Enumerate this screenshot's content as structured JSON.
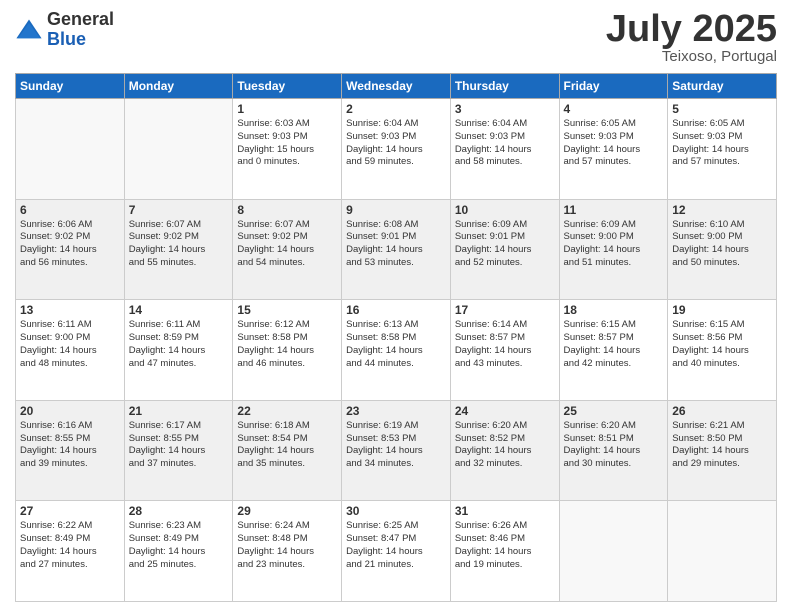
{
  "header": {
    "logo_general": "General",
    "logo_blue": "Blue",
    "month_title": "July 2025",
    "location": "Teixoso, Portugal"
  },
  "weekdays": [
    "Sunday",
    "Monday",
    "Tuesday",
    "Wednesday",
    "Thursday",
    "Friday",
    "Saturday"
  ],
  "weeks": [
    [
      {
        "day": "",
        "info": ""
      },
      {
        "day": "",
        "info": ""
      },
      {
        "day": "1",
        "info": "Sunrise: 6:03 AM\nSunset: 9:03 PM\nDaylight: 15 hours\nand 0 minutes."
      },
      {
        "day": "2",
        "info": "Sunrise: 6:04 AM\nSunset: 9:03 PM\nDaylight: 14 hours\nand 59 minutes."
      },
      {
        "day": "3",
        "info": "Sunrise: 6:04 AM\nSunset: 9:03 PM\nDaylight: 14 hours\nand 58 minutes."
      },
      {
        "day": "4",
        "info": "Sunrise: 6:05 AM\nSunset: 9:03 PM\nDaylight: 14 hours\nand 57 minutes."
      },
      {
        "day": "5",
        "info": "Sunrise: 6:05 AM\nSunset: 9:03 PM\nDaylight: 14 hours\nand 57 minutes."
      }
    ],
    [
      {
        "day": "6",
        "info": "Sunrise: 6:06 AM\nSunset: 9:02 PM\nDaylight: 14 hours\nand 56 minutes."
      },
      {
        "day": "7",
        "info": "Sunrise: 6:07 AM\nSunset: 9:02 PM\nDaylight: 14 hours\nand 55 minutes."
      },
      {
        "day": "8",
        "info": "Sunrise: 6:07 AM\nSunset: 9:02 PM\nDaylight: 14 hours\nand 54 minutes."
      },
      {
        "day": "9",
        "info": "Sunrise: 6:08 AM\nSunset: 9:01 PM\nDaylight: 14 hours\nand 53 minutes."
      },
      {
        "day": "10",
        "info": "Sunrise: 6:09 AM\nSunset: 9:01 PM\nDaylight: 14 hours\nand 52 minutes."
      },
      {
        "day": "11",
        "info": "Sunrise: 6:09 AM\nSunset: 9:00 PM\nDaylight: 14 hours\nand 51 minutes."
      },
      {
        "day": "12",
        "info": "Sunrise: 6:10 AM\nSunset: 9:00 PM\nDaylight: 14 hours\nand 50 minutes."
      }
    ],
    [
      {
        "day": "13",
        "info": "Sunrise: 6:11 AM\nSunset: 9:00 PM\nDaylight: 14 hours\nand 48 minutes."
      },
      {
        "day": "14",
        "info": "Sunrise: 6:11 AM\nSunset: 8:59 PM\nDaylight: 14 hours\nand 47 minutes."
      },
      {
        "day": "15",
        "info": "Sunrise: 6:12 AM\nSunset: 8:58 PM\nDaylight: 14 hours\nand 46 minutes."
      },
      {
        "day": "16",
        "info": "Sunrise: 6:13 AM\nSunset: 8:58 PM\nDaylight: 14 hours\nand 44 minutes."
      },
      {
        "day": "17",
        "info": "Sunrise: 6:14 AM\nSunset: 8:57 PM\nDaylight: 14 hours\nand 43 minutes."
      },
      {
        "day": "18",
        "info": "Sunrise: 6:15 AM\nSunset: 8:57 PM\nDaylight: 14 hours\nand 42 minutes."
      },
      {
        "day": "19",
        "info": "Sunrise: 6:15 AM\nSunset: 8:56 PM\nDaylight: 14 hours\nand 40 minutes."
      }
    ],
    [
      {
        "day": "20",
        "info": "Sunrise: 6:16 AM\nSunset: 8:55 PM\nDaylight: 14 hours\nand 39 minutes."
      },
      {
        "day": "21",
        "info": "Sunrise: 6:17 AM\nSunset: 8:55 PM\nDaylight: 14 hours\nand 37 minutes."
      },
      {
        "day": "22",
        "info": "Sunrise: 6:18 AM\nSunset: 8:54 PM\nDaylight: 14 hours\nand 35 minutes."
      },
      {
        "day": "23",
        "info": "Sunrise: 6:19 AM\nSunset: 8:53 PM\nDaylight: 14 hours\nand 34 minutes."
      },
      {
        "day": "24",
        "info": "Sunrise: 6:20 AM\nSunset: 8:52 PM\nDaylight: 14 hours\nand 32 minutes."
      },
      {
        "day": "25",
        "info": "Sunrise: 6:20 AM\nSunset: 8:51 PM\nDaylight: 14 hours\nand 30 minutes."
      },
      {
        "day": "26",
        "info": "Sunrise: 6:21 AM\nSunset: 8:50 PM\nDaylight: 14 hours\nand 29 minutes."
      }
    ],
    [
      {
        "day": "27",
        "info": "Sunrise: 6:22 AM\nSunset: 8:49 PM\nDaylight: 14 hours\nand 27 minutes."
      },
      {
        "day": "28",
        "info": "Sunrise: 6:23 AM\nSunset: 8:49 PM\nDaylight: 14 hours\nand 25 minutes."
      },
      {
        "day": "29",
        "info": "Sunrise: 6:24 AM\nSunset: 8:48 PM\nDaylight: 14 hours\nand 23 minutes."
      },
      {
        "day": "30",
        "info": "Sunrise: 6:25 AM\nSunset: 8:47 PM\nDaylight: 14 hours\nand 21 minutes."
      },
      {
        "day": "31",
        "info": "Sunrise: 6:26 AM\nSunset: 8:46 PM\nDaylight: 14 hours\nand 19 minutes."
      },
      {
        "day": "",
        "info": ""
      },
      {
        "day": "",
        "info": ""
      }
    ]
  ]
}
